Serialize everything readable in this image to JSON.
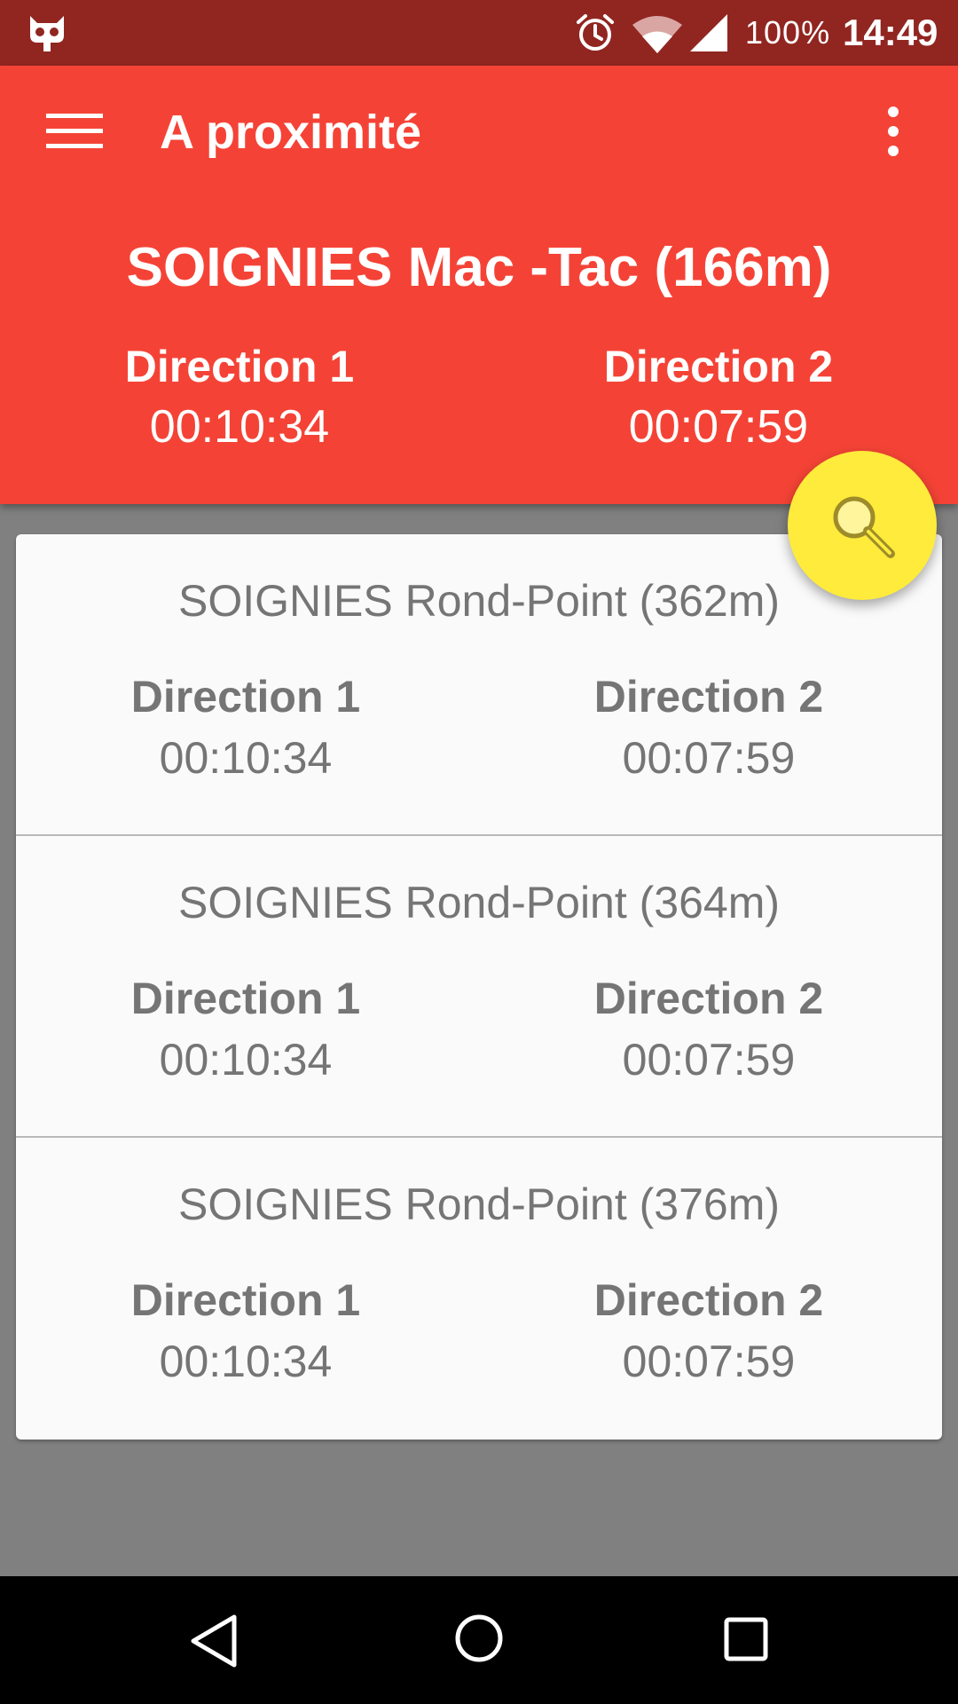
{
  "status_bar": {
    "battery": "100%",
    "time": "14:49",
    "icons": [
      "cyanogenmod-icon",
      "alarm-icon",
      "wifi-icon",
      "cell-signal-icon"
    ]
  },
  "app_bar": {
    "title": "A proximité",
    "background": "#f44336",
    "status_background": "#912621"
  },
  "nearest": {
    "station": "SOIGNIES Mac -Tac (166m)",
    "direction1_label": "Direction 1",
    "direction1_time": "00:10:34",
    "direction2_label": "Direction 2",
    "direction2_time": "00:07:59"
  },
  "fab": {
    "icon": "search-icon",
    "color": "#ffeb3b"
  },
  "stations": [
    {
      "name": "SOIGNIES Rond-Point (362m)",
      "direction1_label": "Direction 1",
      "direction1_time": "00:10:34",
      "direction2_label": "Direction 2",
      "direction2_time": "00:07:59"
    },
    {
      "name": "SOIGNIES Rond-Point (364m)",
      "direction1_label": "Direction 1",
      "direction1_time": "00:10:34",
      "direction2_label": "Direction 2",
      "direction2_time": "00:07:59"
    },
    {
      "name": "SOIGNIES Rond-Point (376m)",
      "direction1_label": "Direction 1",
      "direction1_time": "00:10:34",
      "direction2_label": "Direction 2",
      "direction2_time": "00:07:59"
    }
  ],
  "nav_bar": {
    "icons": [
      "back-icon",
      "home-icon",
      "recents-icon"
    ]
  }
}
